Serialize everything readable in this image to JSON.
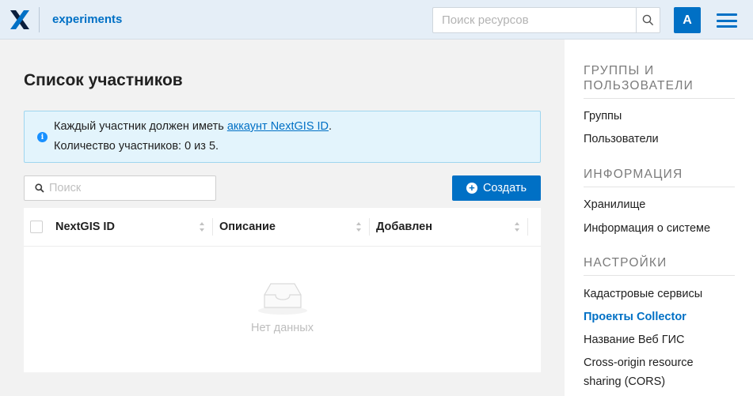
{
  "header": {
    "app_title": "experiments",
    "search_placeholder": "Поиск ресурсов",
    "avatar_letter": "A",
    "accent_color": "#0070c5"
  },
  "main": {
    "page_title": "Список участников",
    "info": {
      "line1_prefix": "Каждый участник должен иметь ",
      "line1_link": "аккаунт NextGIS ID",
      "line1_suffix": ".",
      "line2": "Количество участников: 0 из 5."
    },
    "search_placeholder": "Поиск",
    "create_label": "Создать",
    "table": {
      "columns": [
        "NextGIS ID",
        "Описание",
        "Добавлен"
      ],
      "rows": [],
      "empty_text": "Нет данных"
    }
  },
  "sidebar": {
    "sections": [
      {
        "heading": "Группы и пользователи",
        "items": [
          {
            "label": "Группы",
            "active": false
          },
          {
            "label": "Пользователи",
            "active": false
          }
        ]
      },
      {
        "heading": "Информация",
        "items": [
          {
            "label": "Хранилище",
            "active": false
          },
          {
            "label": "Информация о системе",
            "active": false
          }
        ]
      },
      {
        "heading": "Настройки",
        "items": [
          {
            "label": "Кадастровые сервисы",
            "active": false
          },
          {
            "label": "Проекты Collector",
            "active": true
          },
          {
            "label": "Название Веб ГИС",
            "active": false
          },
          {
            "label": "Cross-origin resource sharing (CORS)",
            "active": false
          }
        ]
      }
    ]
  }
}
